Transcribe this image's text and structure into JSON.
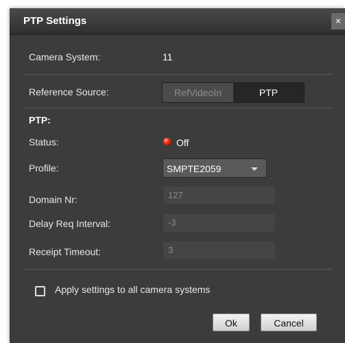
{
  "dialog": {
    "title": "PTP Settings",
    "close_label": "×"
  },
  "camera_system": {
    "label": "Camera System:",
    "value": "11"
  },
  "reference_source": {
    "label": "Reference Source:",
    "options": [
      "RefVideoIn",
      "PTP"
    ],
    "selected": "PTP"
  },
  "ptp": {
    "section_title": "PTP:",
    "status": {
      "label": "Status:",
      "value": "Off",
      "led_color": "#e01a0a"
    },
    "profile": {
      "label": "Profile:",
      "value": "SMPTE2059"
    },
    "domain_nr": {
      "label": "Domain Nr:",
      "value": "127"
    },
    "delay_req_interval": {
      "label": "Delay Req Interval:",
      "value": "-3"
    },
    "receipt_timeout": {
      "label": "Receipt Timeout:",
      "value": "3"
    }
  },
  "apply_all": {
    "label": "Apply settings to all camera systems",
    "checked": false
  },
  "buttons": {
    "ok": "Ok",
    "cancel": "Cancel"
  },
  "colors": {
    "dialog_bg": "#3c3c3c",
    "title_bar": "#2f2f2f",
    "text": "#e8e8e8",
    "disabled_text": "#8a8a8a"
  }
}
